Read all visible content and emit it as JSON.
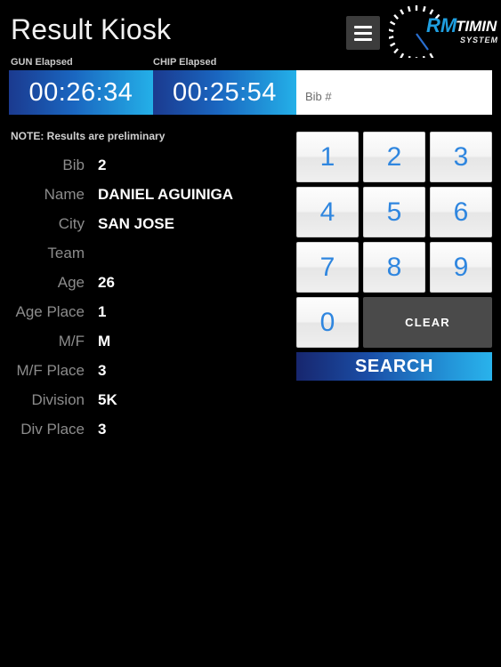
{
  "header": {
    "title": "Result Kiosk",
    "menu_icon": "hamburger-menu-icon",
    "logo": {
      "mark": "RM",
      "word1": "TIMING",
      "word2": "SYSTEMS",
      "mark_color": "#1f9fe0",
      "dial_color": "#ffffff"
    }
  },
  "timers": [
    {
      "label": "GUN Elapsed",
      "value": "00:26:34"
    },
    {
      "label": "CHIP Elapsed",
      "value": "00:25:54"
    }
  ],
  "search": {
    "bib_placeholder": "Bib #",
    "bib_value": "",
    "clear_label": "CLEAR",
    "search_label": "SEARCH",
    "keys": [
      "1",
      "2",
      "3",
      "4",
      "5",
      "6",
      "7",
      "8",
      "9",
      "0"
    ]
  },
  "results": {
    "note": "NOTE: Results are preliminary",
    "fields": [
      {
        "label": "Bib",
        "value": "2"
      },
      {
        "label": "Name",
        "value": "DANIEL AGUINIGA"
      },
      {
        "label": "City",
        "value": "SAN JOSE"
      },
      {
        "label": "Team",
        "value": ""
      },
      {
        "label": "Age",
        "value": "26"
      },
      {
        "label": "Age Place",
        "value": "1"
      },
      {
        "label": "M/F",
        "value": "M"
      },
      {
        "label": "M/F Place",
        "value": "3"
      },
      {
        "label": "Division",
        "value": "5K"
      },
      {
        "label": "Div Place",
        "value": "3"
      }
    ]
  },
  "colors": {
    "background": "#000000",
    "timer_gradient_start": "#1b3a8f",
    "timer_gradient_end": "#24b0e8",
    "key_number": "#2f86df",
    "clear_bg": "#4a4a4a",
    "label_gray": "#8c8c8c"
  }
}
